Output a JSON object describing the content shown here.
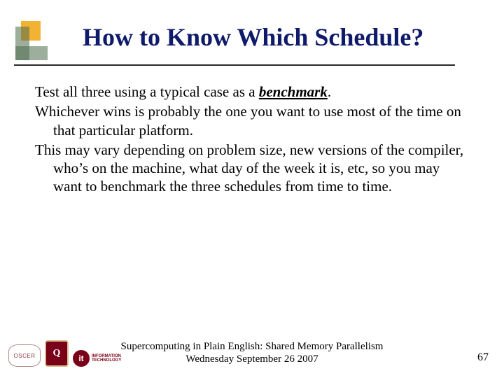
{
  "title": "How to Know Which Schedule?",
  "body": {
    "p1_pre": "Test all three using a typical case as a ",
    "p1_bench": "benchmark",
    "p1_post": ".",
    "p2": "Whichever wins is probably the one you want to use most of the time on that particular platform.",
    "p3": "This may vary depending on problem size, new versions of the compiler, who’s on the machine, what day of the week it is, etc, so you may want to benchmark the three schedules from time to time."
  },
  "footer": {
    "line1": "Supercomputing in Plain English: Shared Memory Parallelism",
    "line2": "Wednesday September 26 2007"
  },
  "page": "67",
  "logos": {
    "oscer": "OSCER",
    "ou": "Q",
    "it_badge": "it",
    "it_line1": "INFORMATION",
    "it_line2": "TECHNOLOGY"
  }
}
